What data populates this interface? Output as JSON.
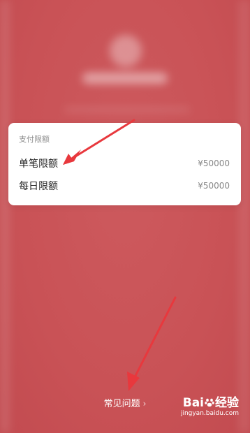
{
  "limits_card": {
    "title": "支付限额",
    "rows": [
      {
        "label": "单笔限额",
        "value": "¥50000"
      },
      {
        "label": "每日限额",
        "value": "¥50000"
      }
    ]
  },
  "footer": {
    "faq_label": "常见问题",
    "chevron": "›"
  },
  "watermark": {
    "brand_left": "Bai",
    "brand_right": "经验",
    "url": "jingyan.baidu.com"
  },
  "colors": {
    "background": "#c95256",
    "card": "#ffffff",
    "arrow": "#e8383d"
  },
  "icons": {
    "annotation": "red-arrow-icon",
    "watermark_logo": "baidu-paw-icon"
  }
}
